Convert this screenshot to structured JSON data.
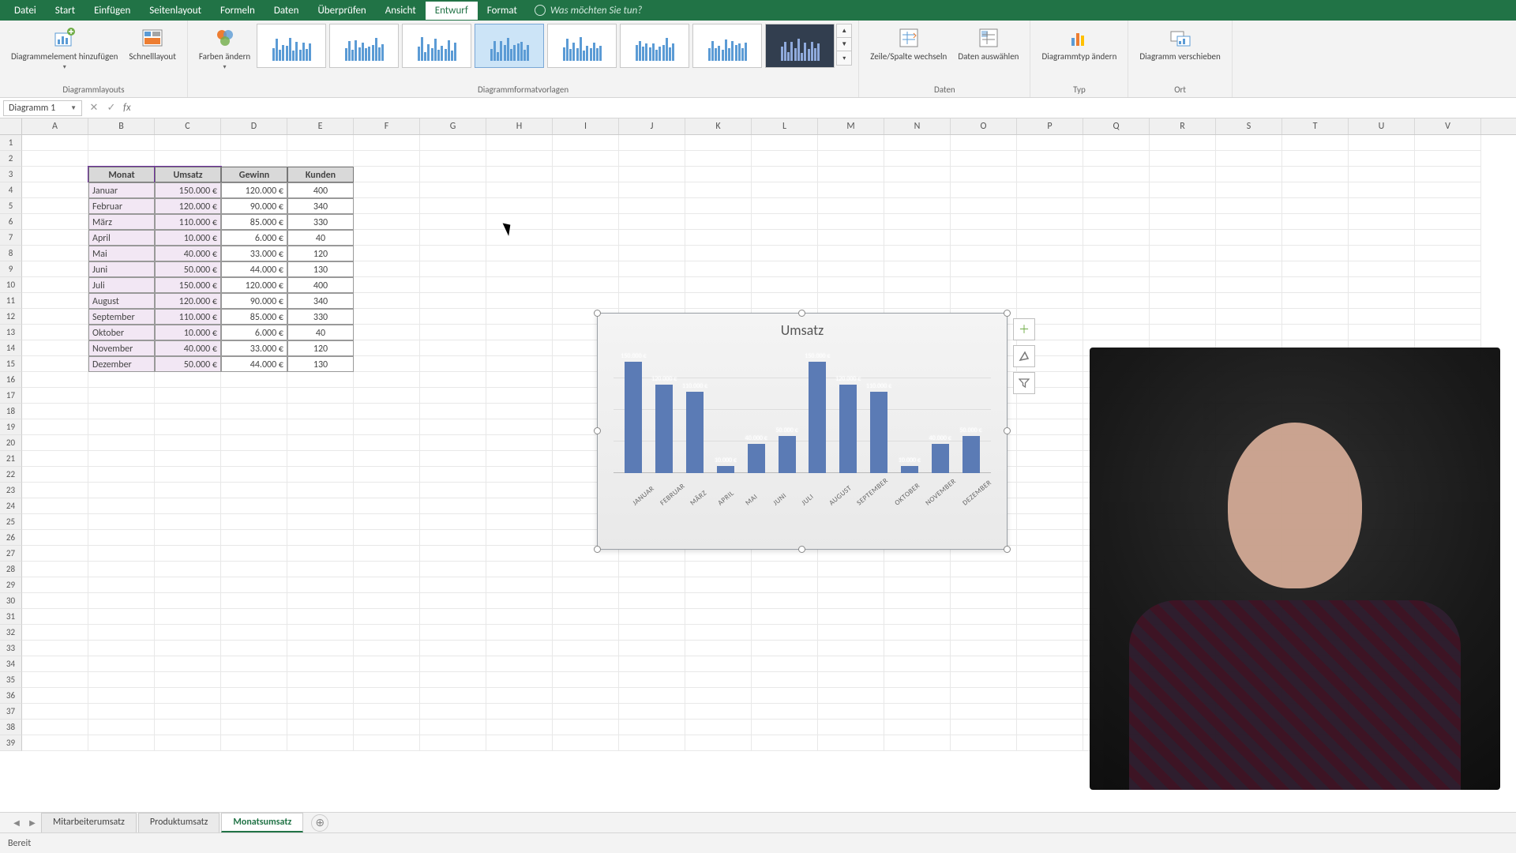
{
  "ribbon_tabs": [
    "Datei",
    "Start",
    "Einfügen",
    "Seitenlayout",
    "Formeln",
    "Daten",
    "Überprüfen",
    "Ansicht",
    "Entwurf",
    "Format"
  ],
  "active_tab": "Entwurf",
  "tell_me": "Was möchten Sie tun?",
  "groups": {
    "layouts": "Diagrammlayouts",
    "styles": "Diagrammformatvorlagen",
    "data": "Daten",
    "type": "Typ",
    "location": "Ort"
  },
  "buttons": {
    "add_element": "Diagrammelement hinzufügen",
    "quick_layout": "Schnelllayout",
    "change_colors": "Farben ändern",
    "switch_rc": "Zeile/Spalte wechseln",
    "select_data": "Daten auswählen",
    "change_type": "Diagrammtyp ändern",
    "move_chart": "Diagramm verschieben"
  },
  "name_box": "Diagramm 1",
  "columns": [
    "A",
    "B",
    "C",
    "D",
    "E",
    "F",
    "G",
    "H",
    "I",
    "J",
    "K",
    "L",
    "M",
    "N",
    "O",
    "P",
    "Q",
    "R",
    "S",
    "T",
    "U",
    "V"
  ],
  "table": {
    "headers": [
      "Monat",
      "Umsatz",
      "Gewinn",
      "Kunden"
    ],
    "rows": [
      [
        "Januar",
        "150.000 €",
        "120.000 €",
        "400"
      ],
      [
        "Februar",
        "120.000 €",
        "90.000 €",
        "340"
      ],
      [
        "März",
        "110.000 €",
        "85.000 €",
        "330"
      ],
      [
        "April",
        "10.000 €",
        "6.000 €",
        "40"
      ],
      [
        "Mai",
        "40.000 €",
        "33.000 €",
        "120"
      ],
      [
        "Juni",
        "50.000 €",
        "44.000 €",
        "130"
      ],
      [
        "Juli",
        "150.000 €",
        "120.000 €",
        "400"
      ],
      [
        "August",
        "120.000 €",
        "90.000 €",
        "340"
      ],
      [
        "September",
        "110.000 €",
        "85.000 €",
        "330"
      ],
      [
        "Oktober",
        "10.000 €",
        "6.000 €",
        "40"
      ],
      [
        "November",
        "40.000 €",
        "33.000 €",
        "120"
      ],
      [
        "Dezember",
        "50.000 €",
        "44.000 €",
        "130"
      ]
    ]
  },
  "chart_data": {
    "type": "bar",
    "title": "Umsatz",
    "categories": [
      "JANUAR",
      "FEBRUAR",
      "MÄRZ",
      "APRIL",
      "MAI",
      "JUNI",
      "JULI",
      "AUGUST",
      "SEPTEMBER",
      "OKTOBER",
      "NOVEMBER",
      "DEZEMBER"
    ],
    "values": [
      150000,
      120000,
      110000,
      10000,
      40000,
      50000,
      150000,
      120000,
      110000,
      10000,
      40000,
      50000
    ],
    "labels": [
      "150.000 €",
      "120.000 €",
      "110.000 €",
      "10.000 €",
      "40.000 €",
      "50.000 €",
      "150.000 €",
      "120.000 €",
      "110.000 €",
      "10.000 €",
      "40.000 €",
      "50.000 €"
    ],
    "ylim": [
      0,
      160000
    ]
  },
  "sheet_tabs": [
    "Mitarbeiterumsatz",
    "Produktumsatz",
    "Monatsumsatz"
  ],
  "active_sheet": "Monatsumsatz",
  "status": "Bereit"
}
